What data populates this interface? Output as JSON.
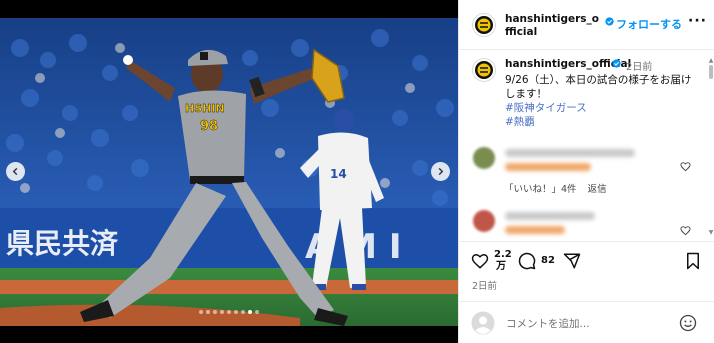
{
  "post": {
    "username": "hanshintigers_official",
    "follow_label": "フォローする",
    "more_label": "···",
    "caption": {
      "username": "hanshintigers_official",
      "time": "2日前",
      "text": "9/26（土）、本日の試合の様子をお届けします！",
      "tags": [
        "#阪神タイガース",
        "#熱覇"
      ]
    },
    "comments": [
      {
        "likes_reply": "「いいね！」4件",
        "reply_label": "返信"
      },
      {
        "likes_reply": "",
        "reply_label": ""
      }
    ],
    "likes_count": "2.2\n万",
    "likes_line1": "2.2",
    "likes_line2": "万",
    "comments_count": "82",
    "date": "2日前",
    "comment_placeholder": "コメントを追加...",
    "photo": {
      "jersey_text": "HSHIN",
      "jersey_number": "98",
      "banner_left": "県民共済",
      "banner_right": "A M I"
    },
    "carousel": {
      "total": 9,
      "active": 8
    }
  },
  "colors": {
    "accent": "#0095f6",
    "hashtag": "#4a6ec5",
    "stands_blue": "#1f4f9e",
    "grass": "#2f7d3a"
  },
  "icons": [
    "tigers-logo-icon",
    "verified-badge-icon",
    "heart-icon",
    "comment-icon",
    "share-icon",
    "bookmark-icon",
    "chevron-left-icon",
    "chevron-right-icon",
    "emoji-icon",
    "user-avatar-icon"
  ]
}
